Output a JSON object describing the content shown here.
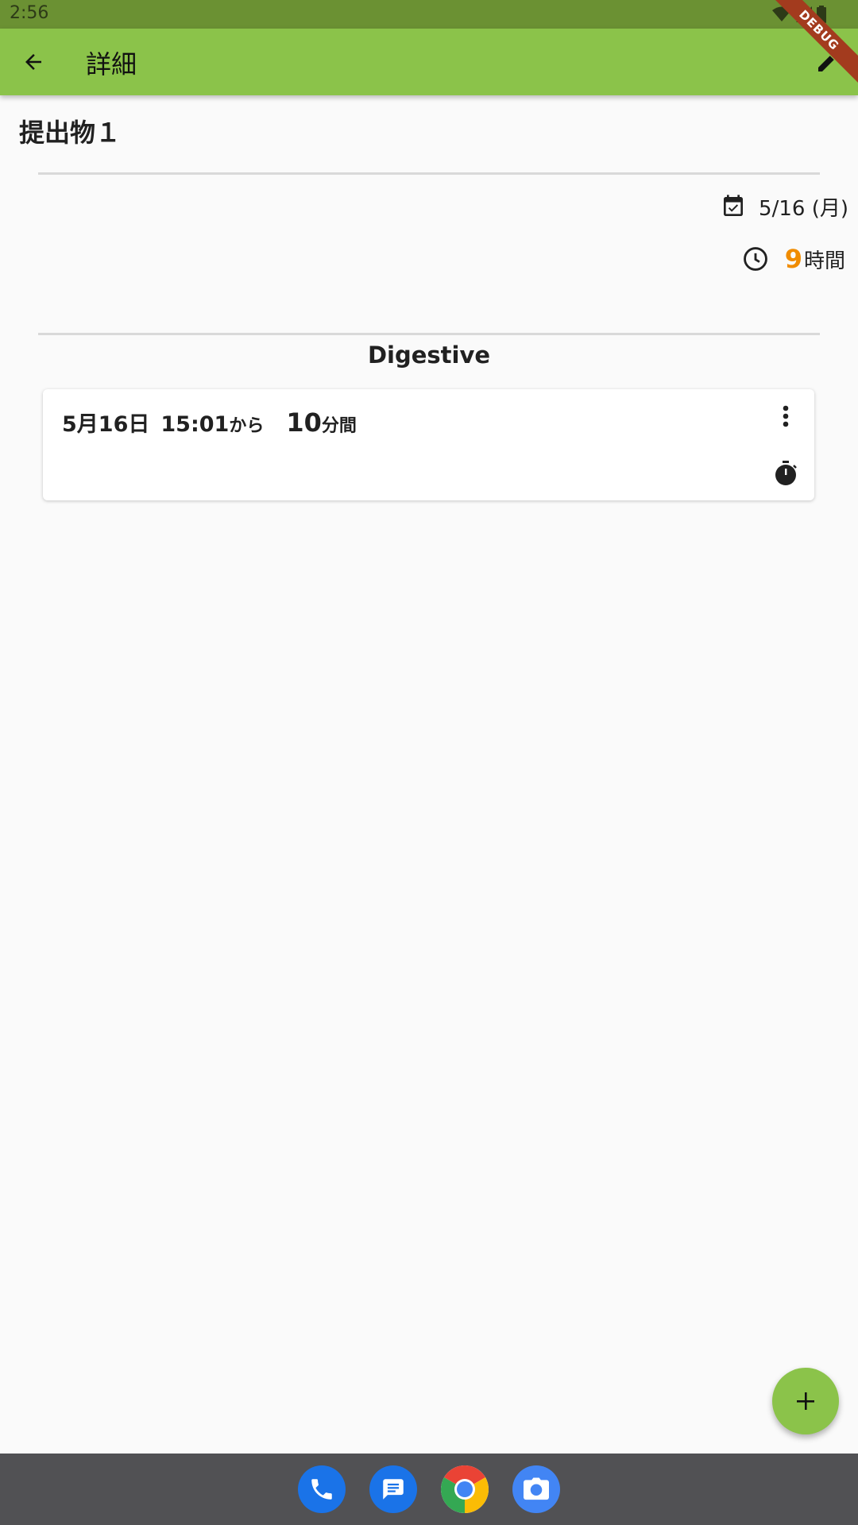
{
  "status_bar": {
    "time": "2:56"
  },
  "app_bar": {
    "title": "詳細",
    "back_icon": "arrow-back-icon",
    "edit_icon": "pencil-icon"
  },
  "debug_banner": {
    "label": "DEBUG"
  },
  "page": {
    "title": "提出物１",
    "date": "5/16 (月)",
    "date_icon": "calendar-check-icon",
    "time_icon": "clock-icon",
    "hours_value": "9",
    "hours_unit": "時間",
    "section_title": "Digestive"
  },
  "sessions": [
    {
      "date": "5月16日",
      "start_time": "15:01",
      "from_label": "から",
      "duration": "10",
      "duration_unit": "分間",
      "more_icon": "more-vert-icon",
      "timer_icon": "stopwatch-icon"
    }
  ],
  "fab": {
    "icon": "plus-icon"
  },
  "dock": {
    "apps": [
      "phone-icon",
      "messages-icon",
      "chrome-icon",
      "camera-icon"
    ]
  },
  "colors": {
    "primary": "#8bc34a",
    "status_bar": "#6b9133",
    "accent_hours": "#f08c00",
    "debug": "#a33b1e",
    "dock": "#515154"
  }
}
